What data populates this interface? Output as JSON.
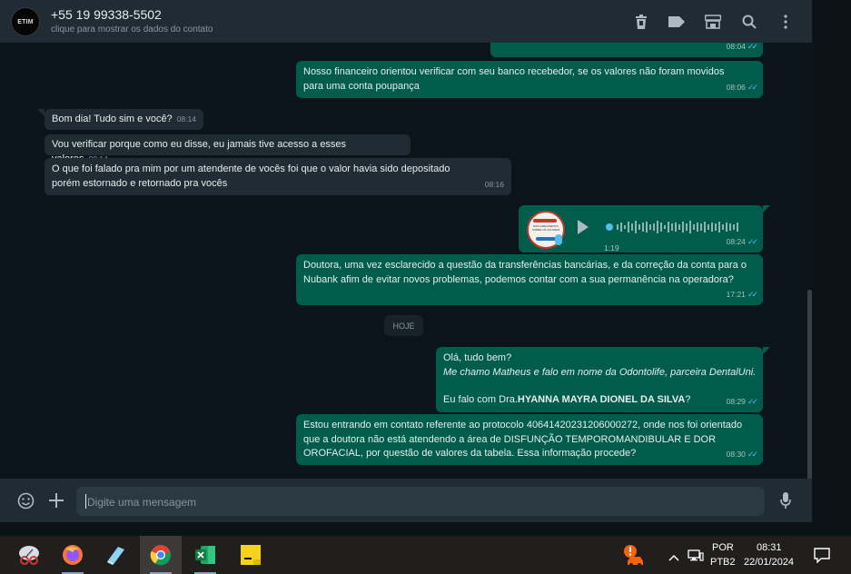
{
  "header": {
    "avatar_text": "ETIM",
    "contact_name": "+55 19 99338-5502",
    "subtitle": "clique para mostrar os dados do contato",
    "icons": [
      "delete-icon",
      "label-icon",
      "shop-icon",
      "search-icon",
      "menu-icon"
    ]
  },
  "messages": [
    {
      "dir": "out",
      "text": "",
      "time": "08:04"
    },
    {
      "dir": "out",
      "text": "Nosso financeiro orientou verificar com seu banco recebedor, se os valores não foram movidos para uma conta poupança",
      "time": "08:06"
    },
    {
      "dir": "in",
      "text": "Bom dia! Tudo sim e você?",
      "time": "08:14"
    },
    {
      "dir": "in",
      "text": "Vou verificar porque como eu disse, eu jamais tive acesso a esses valores",
      "time": "08:14"
    },
    {
      "dir": "in",
      "text": "O que foi falado pra mim por um atendente de vocês foi que o valor havia sido depositado porém estornado e retornado pra vocês",
      "time": "08:16"
    },
    {
      "dir": "out",
      "type": "audio",
      "duration": "1:19",
      "time": "08:24",
      "thumb_text": "ESCLARECIMENTO SOBRE OS VALORES"
    },
    {
      "dir": "out",
      "text": "Doutora, uma vez esclarecido a questão da transferências bancárias, e da correção da conta para o Nubank afim de evitar novos problemas, podemos contar com a sua permanência na operadora?",
      "time": "17:21"
    },
    {
      "dir": "out",
      "line1": "Olá, tudo bem?",
      "line2": "Me chamo Matheus e falo em nome da Odontolife, parceira DentalUni.",
      "line3_prefix": "Eu falo com Dra.",
      "line3_bold": "HYANNA MAYRA DIONEL DA SILVA",
      "line3_suffix": "?",
      "time": "08:29"
    },
    {
      "dir": "out",
      "text": "Estou entrando em contato referente ao protocolo 40641420231206000272, onde nos foi orientado que a doutora não está atendendo a área de DISFUNÇÃO TEMPOROMANDIBULAR E DOR OROFACIAL, por questão de valores da tabela. Essa informação procede?",
      "time": "08:30"
    }
  ],
  "day_chip": "HOJE",
  "composer": {
    "placeholder": "Digite uma mensagem",
    "icons": [
      "emoji-icon",
      "attach-plus-icon",
      "microphone-icon"
    ]
  },
  "taskbar": {
    "apps": [
      "snipping-tool-icon",
      "firefox-icon",
      "app-icon",
      "chrome-icon",
      "excel-icon",
      "sticky-notes-icon"
    ],
    "language": "POR",
    "keyboard": "PTB2",
    "time": "08:31",
    "date": "22/01/2024"
  },
  "colors": {
    "outgoing": "#005c4b",
    "incoming": "#202c33",
    "background": "#0b141a",
    "ticks": "#53bdeb"
  }
}
